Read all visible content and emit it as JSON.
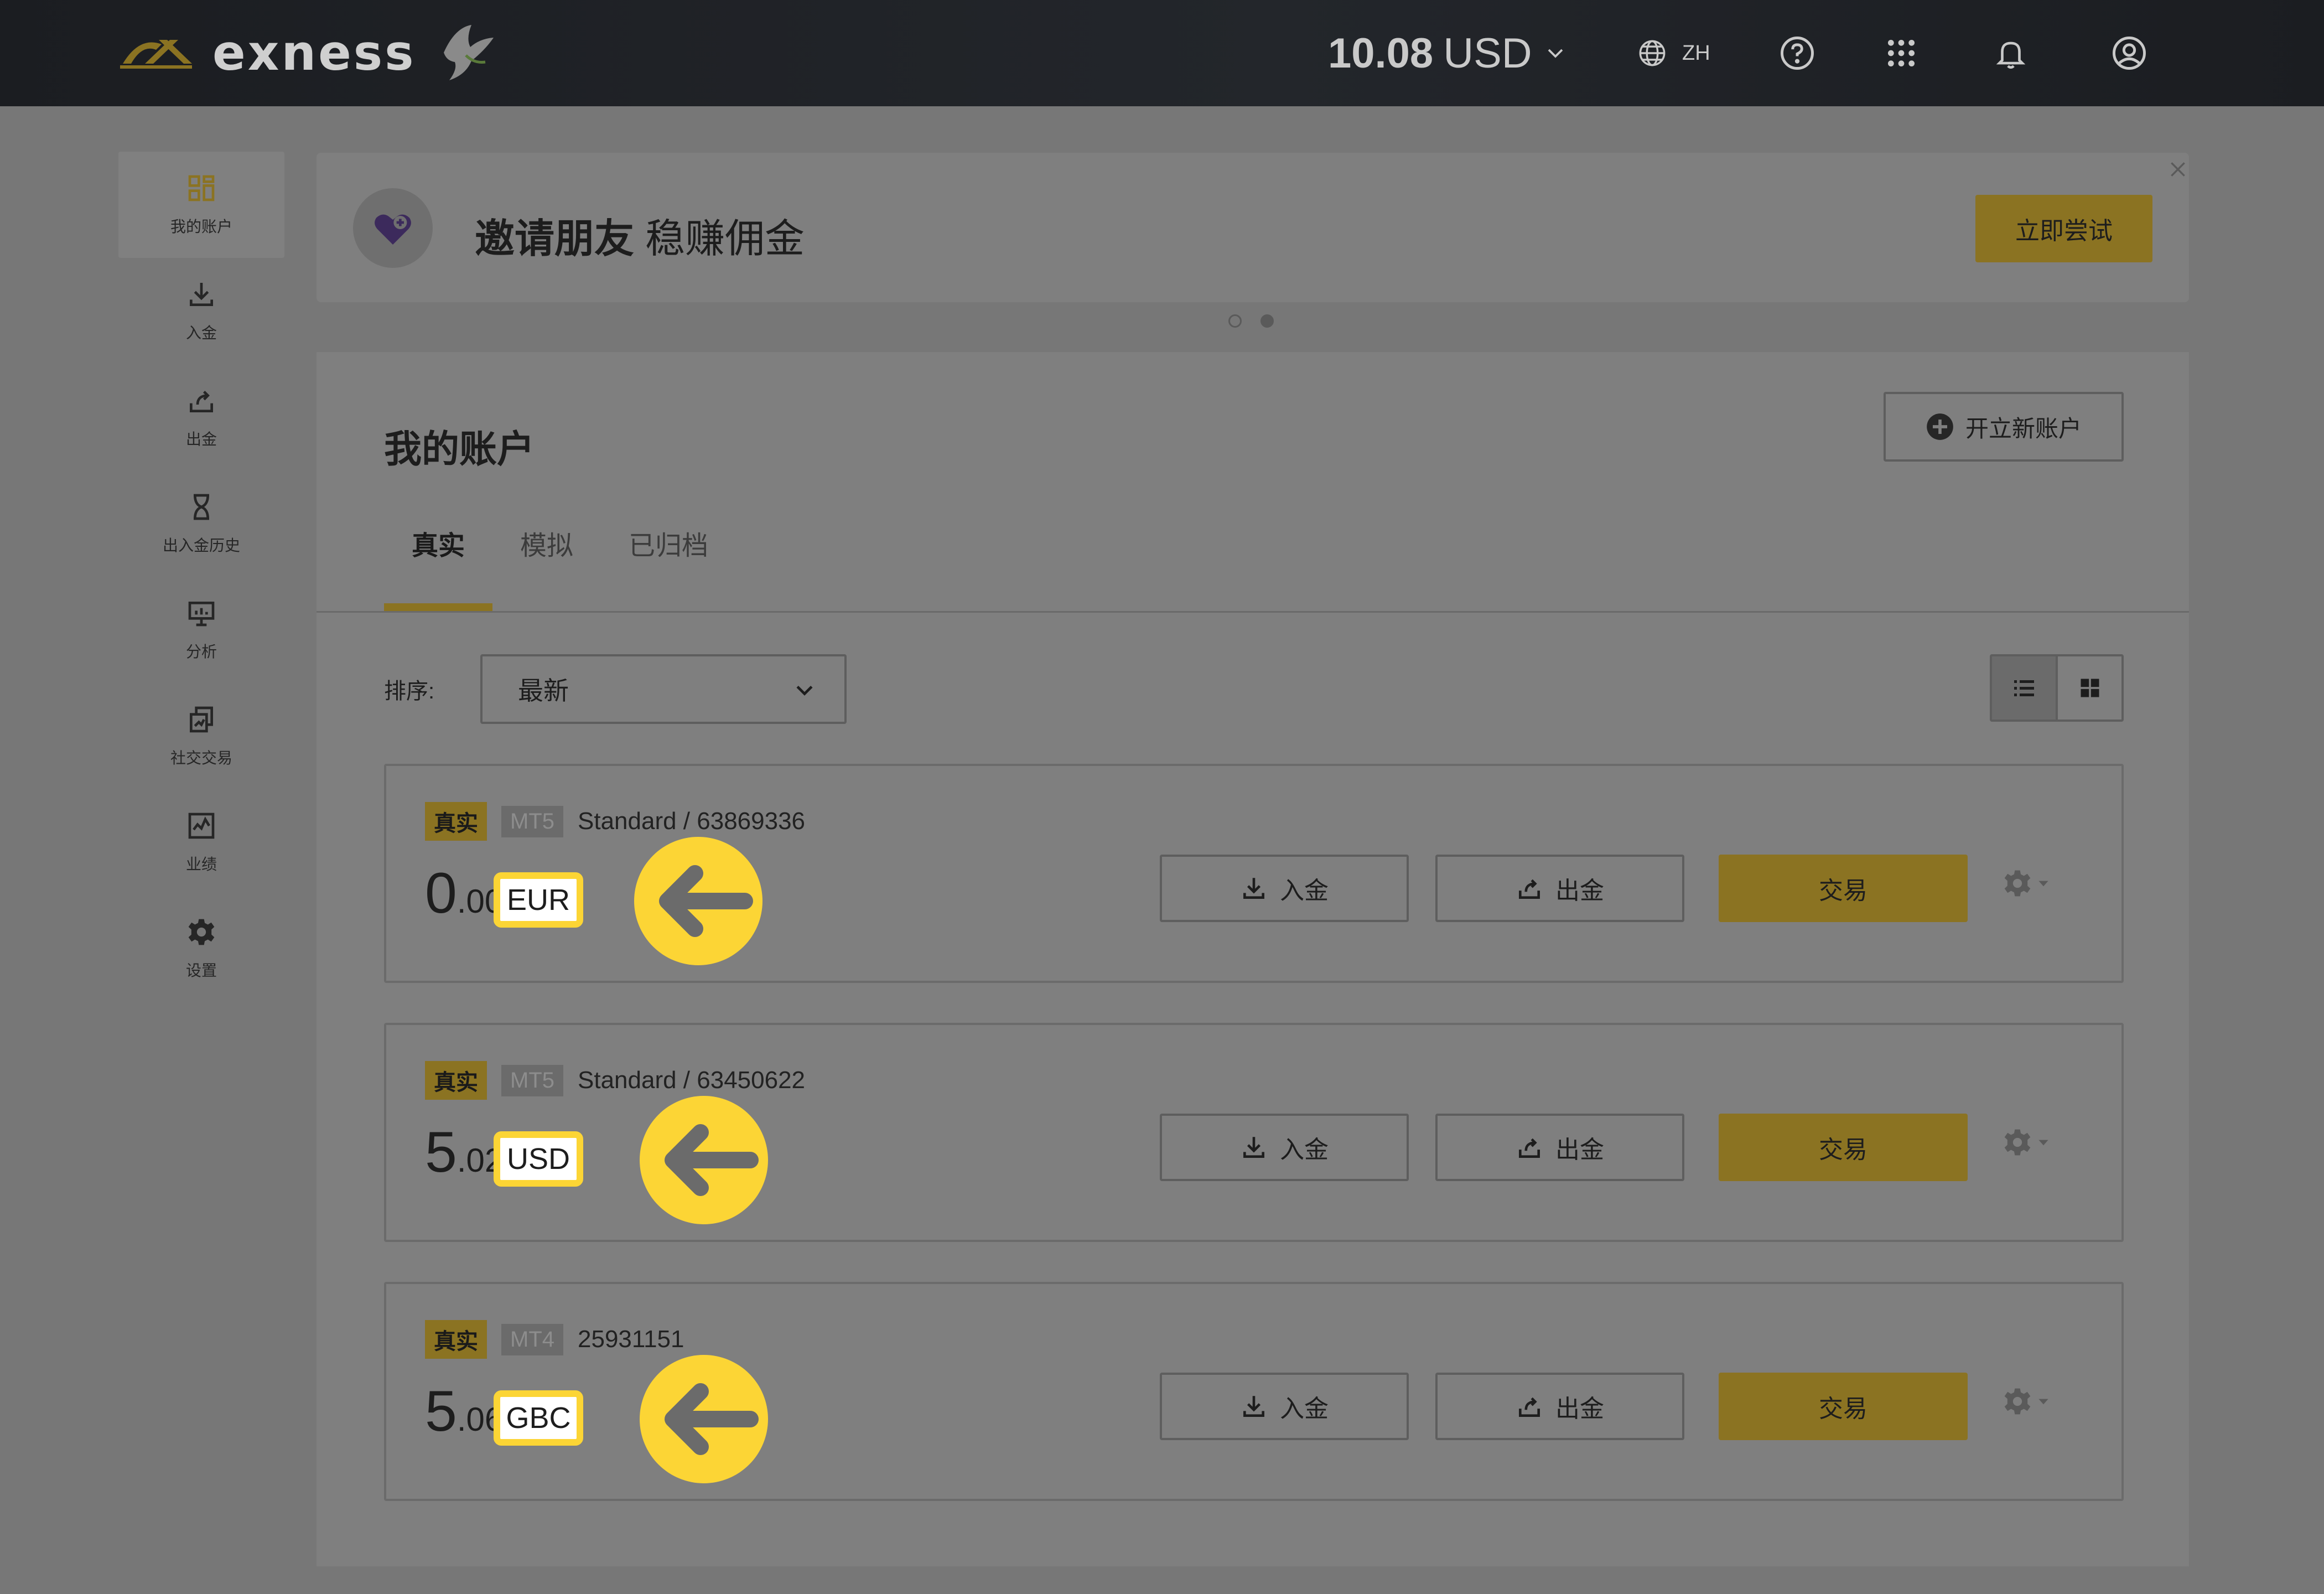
{
  "header": {
    "brand": "exness",
    "balance_amount": "10.08",
    "balance_currency": "USD",
    "language": "ZH",
    "icons": [
      "globe-icon",
      "help-icon",
      "apps-grid-icon",
      "bell-icon",
      "user-icon"
    ]
  },
  "sidebar": {
    "items": [
      {
        "label": "我的账户",
        "icon": "accounts-grid-icon",
        "active": true
      },
      {
        "label": "入金",
        "icon": "download-icon"
      },
      {
        "label": "出金",
        "icon": "upload-icon"
      },
      {
        "label": "出入金历史",
        "icon": "hourglass-icon"
      },
      {
        "label": "分析",
        "icon": "presentation-icon"
      },
      {
        "label": "社交交易",
        "icon": "copy-trading-icon"
      },
      {
        "label": "业绩",
        "icon": "chart-icon"
      },
      {
        "label": "设置",
        "icon": "gear-icon"
      }
    ]
  },
  "promo": {
    "title_bold": "邀请朋友",
    "title_rest": "稳赚佣金",
    "button": "立即尝试"
  },
  "main": {
    "title": "我的账户",
    "open_account": "开立新账户",
    "tabs": [
      "真实",
      "模拟",
      "已归档"
    ],
    "sort_label": "排序:",
    "sort_value": "最新"
  },
  "accounts": [
    {
      "type": "真实",
      "platform": "MT5",
      "name": "Standard / 63869336",
      "int": "0",
      "dec": ".00",
      "currency": "EUR"
    },
    {
      "type": "真实",
      "platform": "MT5",
      "name": "Standard / 63450622",
      "int": "5",
      "dec": ".02",
      "currency": "USD"
    },
    {
      "type": "真实",
      "platform": "MT4",
      "name": "25931151",
      "int": "5",
      "dec": ".06",
      "currency": "GBC"
    }
  ],
  "actions": {
    "deposit": "入金",
    "withdraw": "出金",
    "trade": "交易"
  },
  "colors": {
    "accent": "#8b7322",
    "highlight": "#fcd535",
    "topbar": "#1b1d21"
  }
}
